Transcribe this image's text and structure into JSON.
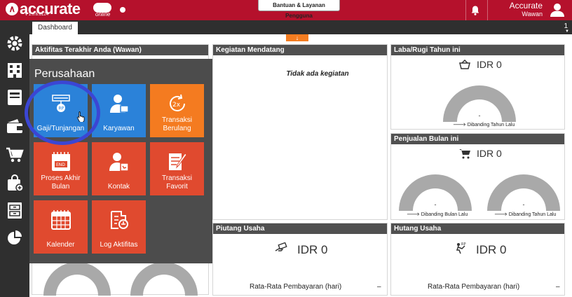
{
  "topbar": {
    "logo_text": "accurate",
    "logo_version": "v 1.0.6.6124",
    "logo_online": "online",
    "help_label": "Bantuan & Layanan Pengguna",
    "app_name": "Accurate",
    "user_name": "Wawan",
    "icons": [
      "bell-icon",
      "user-icon"
    ],
    "brand_color": "#b5112c"
  },
  "sidebar": {
    "icons": [
      "gear-icon",
      "company-icon",
      "ledger-icon",
      "wallet-icon",
      "cart-icon",
      "bag-icon",
      "cabinet-icon",
      "piechart-icon"
    ]
  },
  "tabs": {
    "active": "Dashboard",
    "count": "1"
  },
  "panels": {
    "activity": {
      "title": "Aktifitas Terakhir Anda (Wawan)"
    },
    "upcoming": {
      "title": "Kegiatan Mendatang",
      "empty_text": "Tidak ada kegiatan"
    },
    "profit": {
      "title": "Laba/Rugi Tahun ini",
      "amount": "IDR 0",
      "gauge_value": "-",
      "caption": "Dibanding Tahun Lalu"
    },
    "sales": {
      "title": "Penjualan Bulan ini",
      "amount": "IDR 0",
      "gauge_left_value": "-",
      "gauge_left_caption": "Dibanding Bulan Lalu",
      "gauge_right_value": "-",
      "gauge_right_caption": "Dibanding Tahun Lalu"
    },
    "receivable": {
      "title": "Piutang Usaha",
      "amount": "IDR 0",
      "avg_label": "Rata-Rata Pembayaran (hari)",
      "avg_value": "–"
    },
    "payable": {
      "title": "Hutang Usaha",
      "amount": "IDR 0",
      "avg_label": "Rata-Rata Pembayaran (hari)",
      "avg_value": "–"
    }
  },
  "overlay": {
    "title": "Perusahaan",
    "tiles": [
      {
        "label": "Gaji/Tunjangan",
        "icon": "payroll-icon",
        "color": "#2b82d9"
      },
      {
        "label": "Karyawan",
        "icon": "employee-icon",
        "color": "#2b82d9"
      },
      {
        "label": "Transaksi Berulang",
        "icon": "recurring-icon",
        "color": "#f47b20"
      },
      {
        "label": "Proses Akhir Bulan",
        "icon": "month-end-icon",
        "color": "#e04a2f"
      },
      {
        "label": "Kontak",
        "icon": "contact-icon",
        "color": "#e04a2f"
      },
      {
        "label": "Transaksi Favorit",
        "icon": "favorite-transaction-icon",
        "color": "#e04a2f"
      },
      {
        "label": "Kalender",
        "icon": "calendar-icon",
        "color": "#e04a2f"
      },
      {
        "label": "Log Aktifitas",
        "icon": "activity-log-icon",
        "color": "#e04a2f"
      }
    ]
  }
}
